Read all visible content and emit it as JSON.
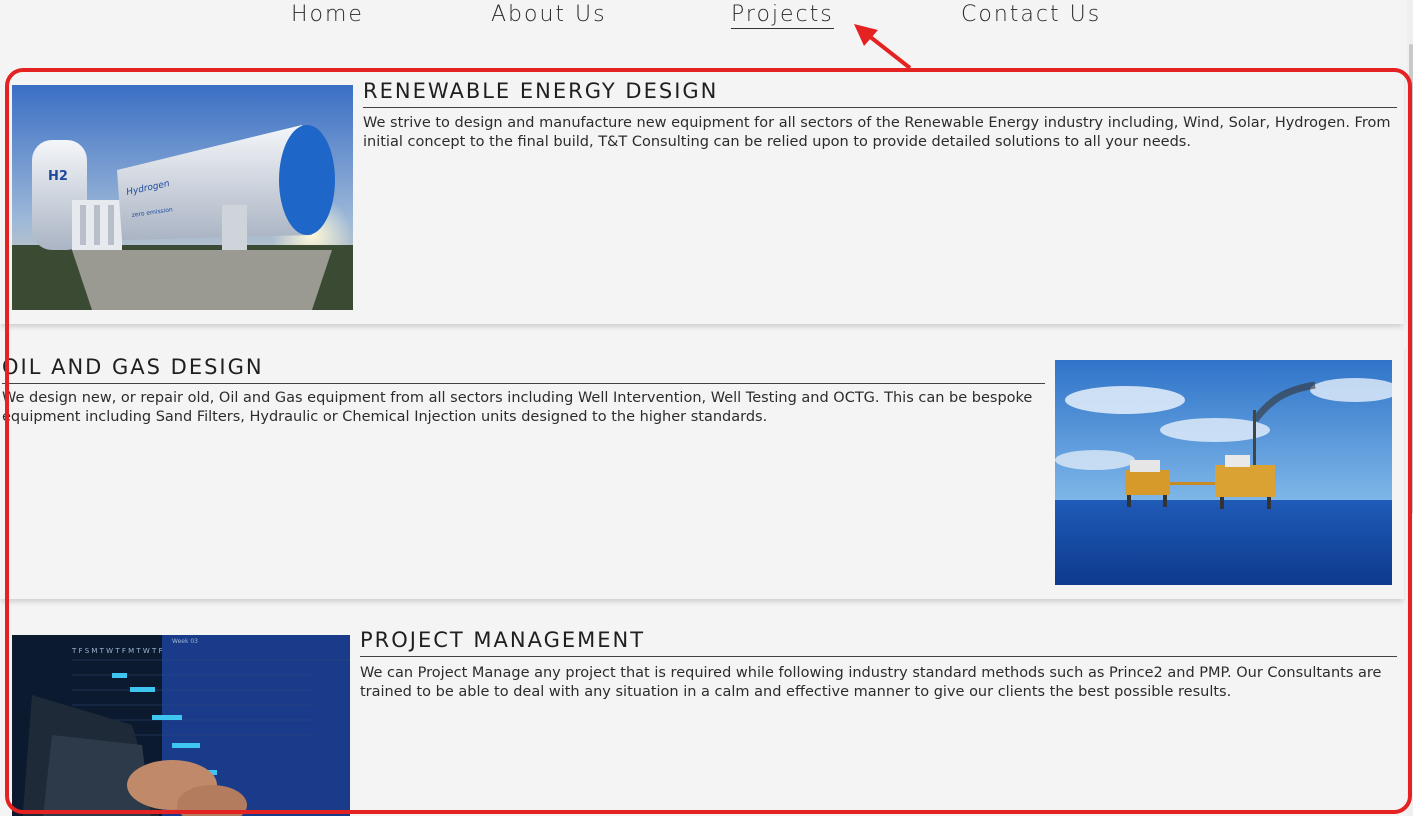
{
  "nav": {
    "items": [
      {
        "label": "Home"
      },
      {
        "label": "About Us"
      },
      {
        "label": "Projects",
        "active": true
      },
      {
        "label": "Contact Us"
      }
    ]
  },
  "sections": [
    {
      "title": "RENEWABLE ENERGY DESIGN",
      "description": "We strive to design and manufacture new equipment for all sectors of the Renewable Energy industry including, Wind, Solar, Hydrogen. From initial concept to the final build, T&T Consulting can be relied upon to provide detailed solutions to all your needs.",
      "image": {
        "label_h2": "H2",
        "label_hydrogen": "Hydrogen",
        "label_emission": "zero emission"
      }
    },
    {
      "title": "OIL AND GAS DESIGN",
      "description": "We design new, or repair old, Oil and Gas equipment from all sectors including Well Intervention, Well Testing and OCTG. This can be bespoke equipment including Sand Filters, Hydraulic or Chemical Injection units designed to the higher standards."
    },
    {
      "title": "PROJECT MANAGEMENT",
      "description": "We can Project Manage any project that is required while following industry standard methods such as Prince2 and PMP. Our Consultants are trained to be able to deal with any situation in a calm and effective manner to give our clients the best possible results.",
      "image": {
        "header_days": "T F S M T W T F M T W T F",
        "week_label": "Week 03"
      }
    }
  ],
  "colors": {
    "background": "#f4f4f4",
    "text": "#222222",
    "annotation": "#e42222",
    "sea": "#1746a8",
    "sky": "#3f86d3"
  }
}
